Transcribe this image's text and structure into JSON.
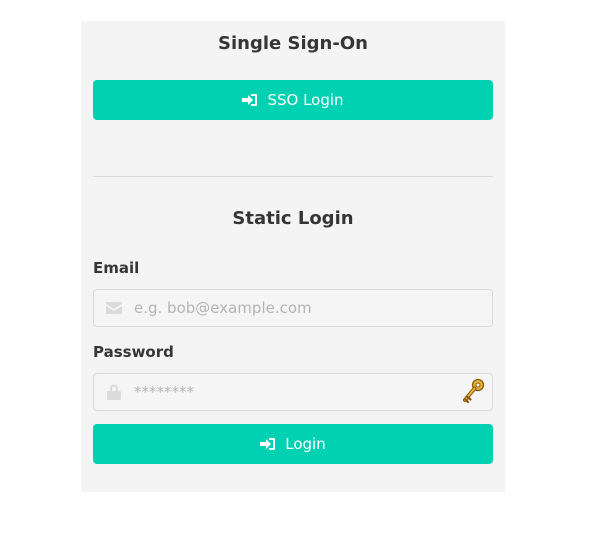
{
  "sso": {
    "heading": "Single Sign-On",
    "button_label": "SSO Login",
    "button_icon": "sign-in-icon"
  },
  "static_login": {
    "heading": "Static Login",
    "email": {
      "label": "Email",
      "placeholder": "e.g. bob@example.com",
      "value": "",
      "icon": "envelope-icon"
    },
    "password": {
      "label": "Password",
      "placeholder": "********",
      "value": "",
      "icon": "lock-icon",
      "extension_icon": "key-icon"
    },
    "button_label": "Login",
    "button_icon": "sign-in-icon"
  },
  "colors": {
    "primary": "#00d1b2",
    "panel_background": "#f4f4f4",
    "heading_text": "#363636",
    "placeholder_text": "#b5b5b5",
    "icon_gray": "#dbdbdb"
  }
}
